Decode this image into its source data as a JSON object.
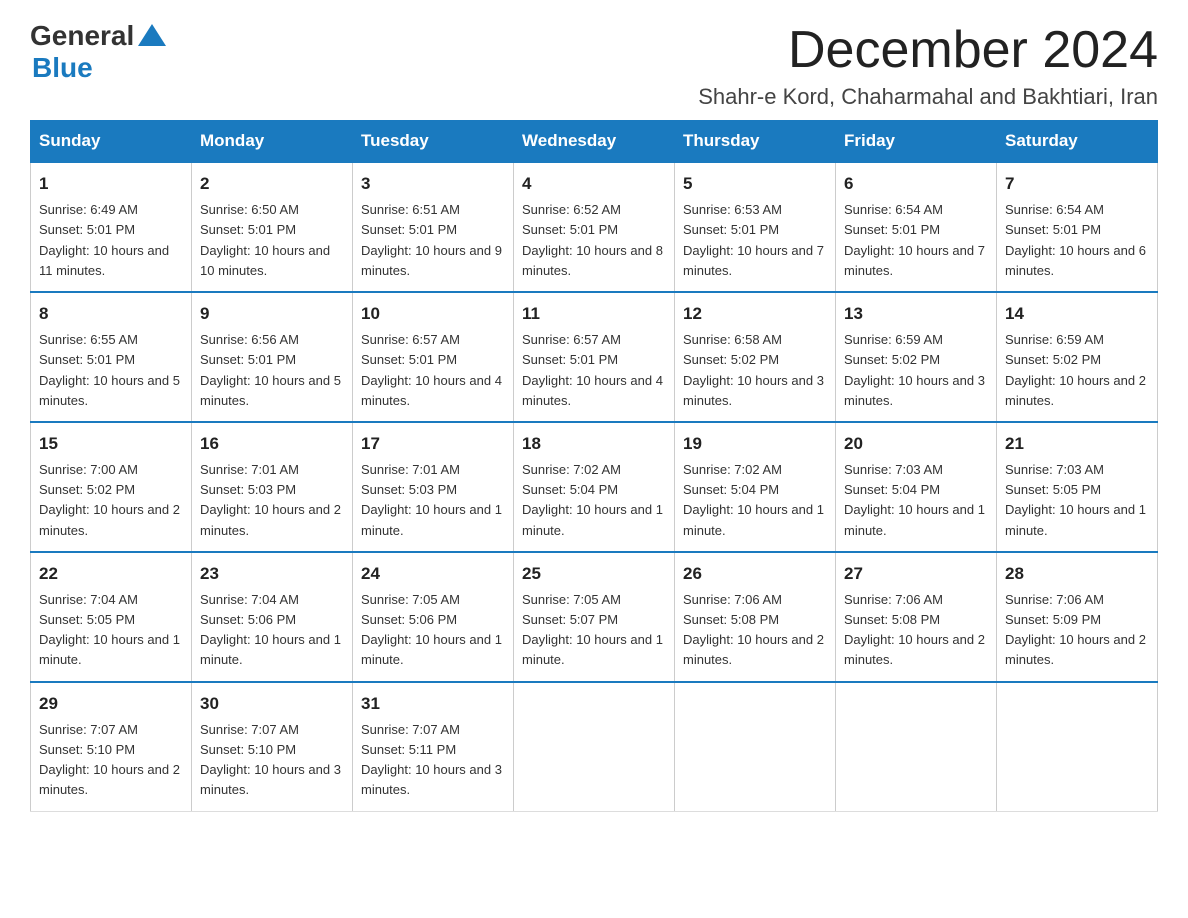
{
  "header": {
    "logo_general": "General",
    "logo_blue": "Blue",
    "title": "December 2024",
    "subtitle": "Shahr-e Kord, Chaharmahal and Bakhtiari, Iran"
  },
  "days_of_week": [
    "Sunday",
    "Monday",
    "Tuesday",
    "Wednesday",
    "Thursday",
    "Friday",
    "Saturday"
  ],
  "weeks": [
    [
      {
        "day": "1",
        "sunrise": "Sunrise: 6:49 AM",
        "sunset": "Sunset: 5:01 PM",
        "daylight": "Daylight: 10 hours and 11 minutes."
      },
      {
        "day": "2",
        "sunrise": "Sunrise: 6:50 AM",
        "sunset": "Sunset: 5:01 PM",
        "daylight": "Daylight: 10 hours and 10 minutes."
      },
      {
        "day": "3",
        "sunrise": "Sunrise: 6:51 AM",
        "sunset": "Sunset: 5:01 PM",
        "daylight": "Daylight: 10 hours and 9 minutes."
      },
      {
        "day": "4",
        "sunrise": "Sunrise: 6:52 AM",
        "sunset": "Sunset: 5:01 PM",
        "daylight": "Daylight: 10 hours and 8 minutes."
      },
      {
        "day": "5",
        "sunrise": "Sunrise: 6:53 AM",
        "sunset": "Sunset: 5:01 PM",
        "daylight": "Daylight: 10 hours and 7 minutes."
      },
      {
        "day": "6",
        "sunrise": "Sunrise: 6:54 AM",
        "sunset": "Sunset: 5:01 PM",
        "daylight": "Daylight: 10 hours and 7 minutes."
      },
      {
        "day": "7",
        "sunrise": "Sunrise: 6:54 AM",
        "sunset": "Sunset: 5:01 PM",
        "daylight": "Daylight: 10 hours and 6 minutes."
      }
    ],
    [
      {
        "day": "8",
        "sunrise": "Sunrise: 6:55 AM",
        "sunset": "Sunset: 5:01 PM",
        "daylight": "Daylight: 10 hours and 5 minutes."
      },
      {
        "day": "9",
        "sunrise": "Sunrise: 6:56 AM",
        "sunset": "Sunset: 5:01 PM",
        "daylight": "Daylight: 10 hours and 5 minutes."
      },
      {
        "day": "10",
        "sunrise": "Sunrise: 6:57 AM",
        "sunset": "Sunset: 5:01 PM",
        "daylight": "Daylight: 10 hours and 4 minutes."
      },
      {
        "day": "11",
        "sunrise": "Sunrise: 6:57 AM",
        "sunset": "Sunset: 5:01 PM",
        "daylight": "Daylight: 10 hours and 4 minutes."
      },
      {
        "day": "12",
        "sunrise": "Sunrise: 6:58 AM",
        "sunset": "Sunset: 5:02 PM",
        "daylight": "Daylight: 10 hours and 3 minutes."
      },
      {
        "day": "13",
        "sunrise": "Sunrise: 6:59 AM",
        "sunset": "Sunset: 5:02 PM",
        "daylight": "Daylight: 10 hours and 3 minutes."
      },
      {
        "day": "14",
        "sunrise": "Sunrise: 6:59 AM",
        "sunset": "Sunset: 5:02 PM",
        "daylight": "Daylight: 10 hours and 2 minutes."
      }
    ],
    [
      {
        "day": "15",
        "sunrise": "Sunrise: 7:00 AM",
        "sunset": "Sunset: 5:02 PM",
        "daylight": "Daylight: 10 hours and 2 minutes."
      },
      {
        "day": "16",
        "sunrise": "Sunrise: 7:01 AM",
        "sunset": "Sunset: 5:03 PM",
        "daylight": "Daylight: 10 hours and 2 minutes."
      },
      {
        "day": "17",
        "sunrise": "Sunrise: 7:01 AM",
        "sunset": "Sunset: 5:03 PM",
        "daylight": "Daylight: 10 hours and 1 minute."
      },
      {
        "day": "18",
        "sunrise": "Sunrise: 7:02 AM",
        "sunset": "Sunset: 5:04 PM",
        "daylight": "Daylight: 10 hours and 1 minute."
      },
      {
        "day": "19",
        "sunrise": "Sunrise: 7:02 AM",
        "sunset": "Sunset: 5:04 PM",
        "daylight": "Daylight: 10 hours and 1 minute."
      },
      {
        "day": "20",
        "sunrise": "Sunrise: 7:03 AM",
        "sunset": "Sunset: 5:04 PM",
        "daylight": "Daylight: 10 hours and 1 minute."
      },
      {
        "day": "21",
        "sunrise": "Sunrise: 7:03 AM",
        "sunset": "Sunset: 5:05 PM",
        "daylight": "Daylight: 10 hours and 1 minute."
      }
    ],
    [
      {
        "day": "22",
        "sunrise": "Sunrise: 7:04 AM",
        "sunset": "Sunset: 5:05 PM",
        "daylight": "Daylight: 10 hours and 1 minute."
      },
      {
        "day": "23",
        "sunrise": "Sunrise: 7:04 AM",
        "sunset": "Sunset: 5:06 PM",
        "daylight": "Daylight: 10 hours and 1 minute."
      },
      {
        "day": "24",
        "sunrise": "Sunrise: 7:05 AM",
        "sunset": "Sunset: 5:06 PM",
        "daylight": "Daylight: 10 hours and 1 minute."
      },
      {
        "day": "25",
        "sunrise": "Sunrise: 7:05 AM",
        "sunset": "Sunset: 5:07 PM",
        "daylight": "Daylight: 10 hours and 1 minute."
      },
      {
        "day": "26",
        "sunrise": "Sunrise: 7:06 AM",
        "sunset": "Sunset: 5:08 PM",
        "daylight": "Daylight: 10 hours and 2 minutes."
      },
      {
        "day": "27",
        "sunrise": "Sunrise: 7:06 AM",
        "sunset": "Sunset: 5:08 PM",
        "daylight": "Daylight: 10 hours and 2 minutes."
      },
      {
        "day": "28",
        "sunrise": "Sunrise: 7:06 AM",
        "sunset": "Sunset: 5:09 PM",
        "daylight": "Daylight: 10 hours and 2 minutes."
      }
    ],
    [
      {
        "day": "29",
        "sunrise": "Sunrise: 7:07 AM",
        "sunset": "Sunset: 5:10 PM",
        "daylight": "Daylight: 10 hours and 2 minutes."
      },
      {
        "day": "30",
        "sunrise": "Sunrise: 7:07 AM",
        "sunset": "Sunset: 5:10 PM",
        "daylight": "Daylight: 10 hours and 3 minutes."
      },
      {
        "day": "31",
        "sunrise": "Sunrise: 7:07 AM",
        "sunset": "Sunset: 5:11 PM",
        "daylight": "Daylight: 10 hours and 3 minutes."
      },
      {
        "day": "",
        "sunrise": "",
        "sunset": "",
        "daylight": ""
      },
      {
        "day": "",
        "sunrise": "",
        "sunset": "",
        "daylight": ""
      },
      {
        "day": "",
        "sunrise": "",
        "sunset": "",
        "daylight": ""
      },
      {
        "day": "",
        "sunrise": "",
        "sunset": "",
        "daylight": ""
      }
    ]
  ]
}
